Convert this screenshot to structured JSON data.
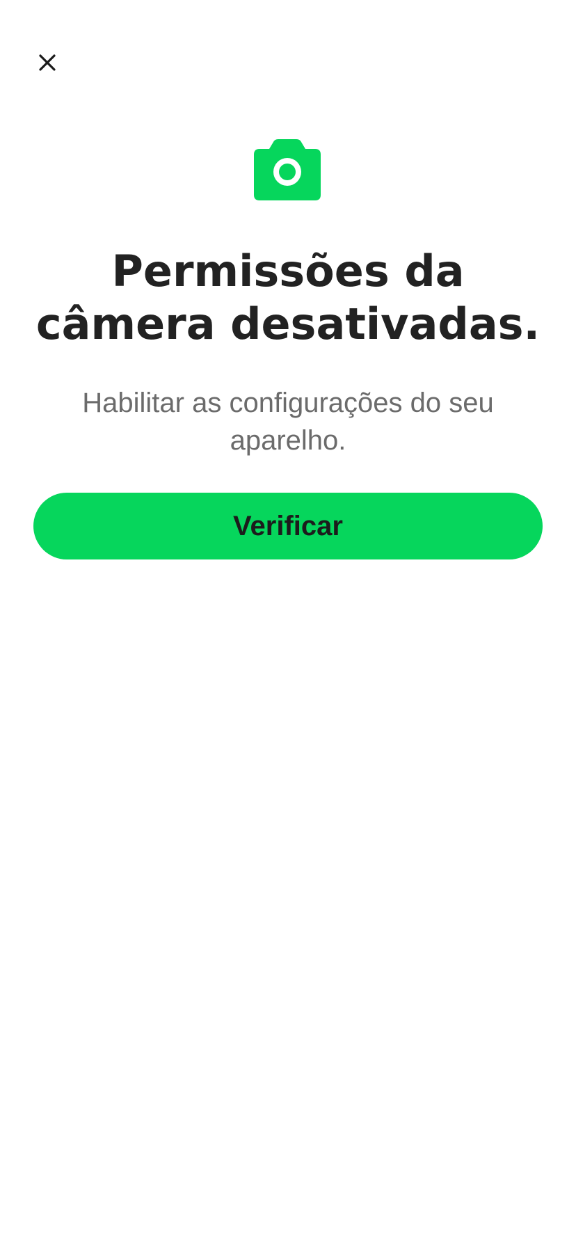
{
  "header": {
    "close_icon": "close-icon"
  },
  "hero": {
    "icon": "camera-icon",
    "accent_color": "#06d65c"
  },
  "content": {
    "title": "Permissões da câmera desativadas.",
    "subtitle": "Habilitar as configurações do seu aparelho."
  },
  "actions": {
    "verify_label": "Verificar",
    "button_color": "#06d65c"
  }
}
